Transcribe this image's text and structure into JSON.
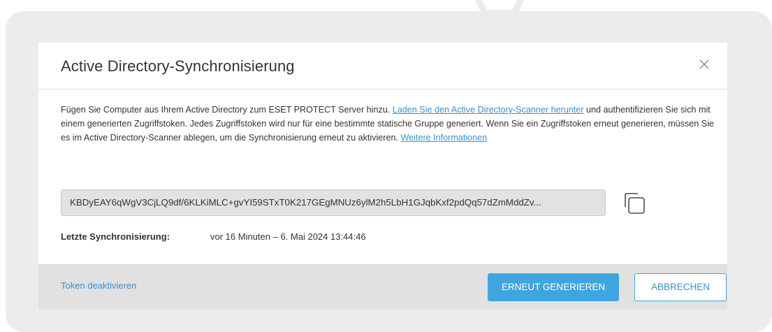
{
  "dialog": {
    "title": "Active Directory-Synchronisierung",
    "close_icon": "close-icon"
  },
  "description": {
    "part1": "Fügen Sie Computer aus Ihrem Active Directory zum ESET PROTECT Server hinzu. ",
    "link1": "Laden Sie den Active Directory-Scanner herunter",
    "part2": " und authentifizieren Sie sich mit einem generierten Zugriffstoken. Jedes Zugriffstoken wird nur für eine bestimmte statische Gruppe generiert. Wenn Sie ein Zugriffstoken erneut generieren, müssen Sie es im Active Directory-Scanner ablegen, um die Synchronisierung erneut zu aktivieren. ",
    "link2": "Weitere Informationen"
  },
  "token": {
    "value": "KBDyEAY6qWgV3CjLQ9df/6KLKiMLC+gvYI59STxT0K217GEgMNUz6ylM2h5LbH1GJqbKxf2pdQq57dZmMddZv...",
    "copy_icon": "copy-icon"
  },
  "sync": {
    "label": "Letzte Synchronisierung:",
    "value": "vor 16 Minuten – 6. Mai 2024 13:44:46"
  },
  "footer": {
    "deactivate_label": "Token deaktivieren",
    "regenerate_label": "ERNEUT GENERIEREN",
    "cancel_label": "ABBRECHEN"
  },
  "colors": {
    "accent": "#3fa5de",
    "link": "#3a8fd0",
    "backdrop": "#ececed",
    "footer_bg": "#e1e1e2"
  }
}
